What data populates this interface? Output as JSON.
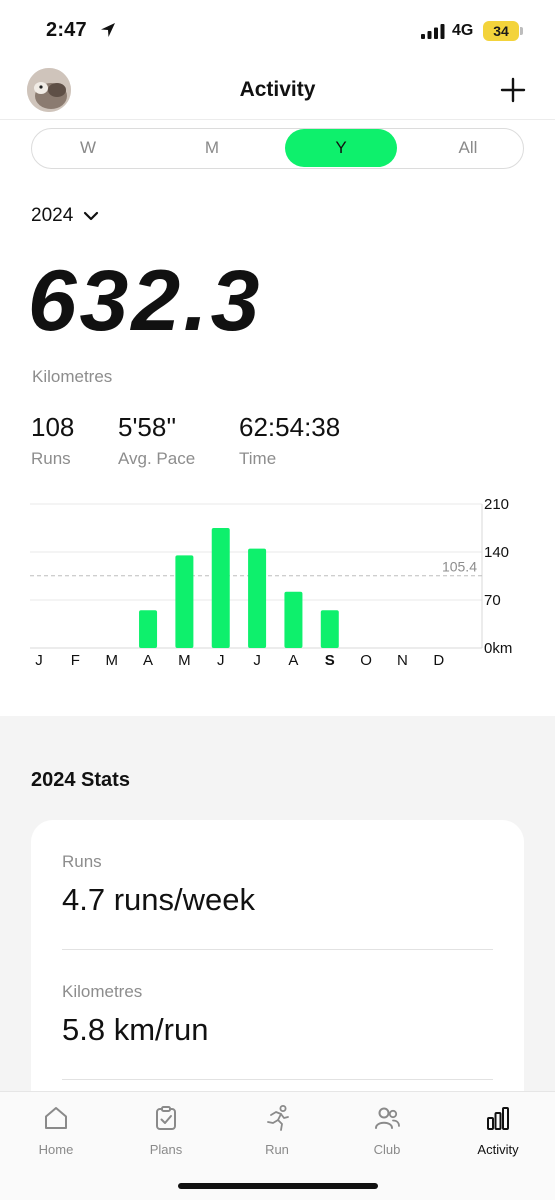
{
  "status_bar": {
    "time": "2:47",
    "network": "4G",
    "battery": "34"
  },
  "header": {
    "title": "Activity",
    "avatar_icon": "avatar-photo",
    "add_icon": "plus-icon"
  },
  "period_tabs": [
    {
      "label": "W",
      "selected": false
    },
    {
      "label": "M",
      "selected": false
    },
    {
      "label": "Y",
      "selected": true
    },
    {
      "label": "All",
      "selected": false
    }
  ],
  "year_selector": {
    "label": "2024"
  },
  "distance": {
    "value": "632.3",
    "unit_label": "Kilometres"
  },
  "summary": {
    "runs_value": "108",
    "runs_label": "Runs",
    "pace_value": "5'58''",
    "pace_label": "Avg. Pace",
    "time_value": "62:54:38",
    "time_label": "Time"
  },
  "chart_data": {
    "type": "bar",
    "categories": [
      "J",
      "F",
      "M",
      "A",
      "M",
      "J",
      "J",
      "A",
      "S",
      "O",
      "N",
      "D"
    ],
    "values": [
      0,
      0,
      0,
      55,
      135,
      175,
      145,
      82,
      55,
      0,
      0,
      0
    ],
    "y_ticks": [
      210,
      140,
      70,
      0
    ],
    "y_tick_labels": [
      "210",
      "140",
      "70",
      "0km"
    ],
    "ylim": [
      0,
      210
    ],
    "reference_line": {
      "value": 105.4,
      "label": "105.4"
    },
    "bold_category_index": 8,
    "bar_color": "#0ef06c",
    "grid": true
  },
  "stats_section": {
    "title": "2024 Stats",
    "items": [
      {
        "label": "Runs",
        "value": "4.7 runs/week"
      },
      {
        "label": "Kilometres",
        "value": "5.8 km/run"
      }
    ]
  },
  "tab_bar": {
    "tabs": [
      {
        "label": "Home",
        "icon": "home-icon",
        "active": false
      },
      {
        "label": "Plans",
        "icon": "clipboard-check-icon",
        "active": false
      },
      {
        "label": "Run",
        "icon": "runner-icon",
        "active": false
      },
      {
        "label": "Club",
        "icon": "people-icon",
        "active": false
      },
      {
        "label": "Activity",
        "icon": "bar-chart-icon",
        "active": true
      }
    ]
  },
  "colors": {
    "accent": "#0ef06c",
    "battery": "#f3d33b",
    "muted_text": "#8d8d8d"
  }
}
